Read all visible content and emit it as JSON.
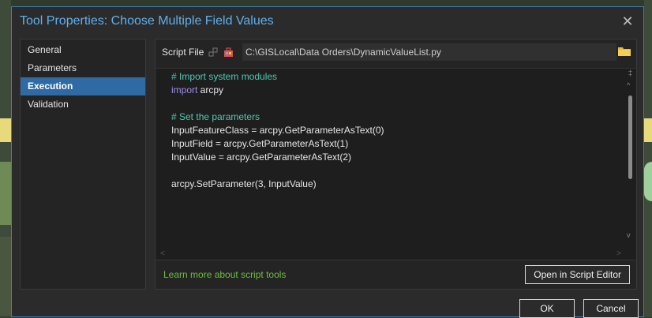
{
  "dialog": {
    "title": "Tool Properties: Choose Multiple Field Values",
    "close_glyph": "✕"
  },
  "sidebar": {
    "items": [
      {
        "label": "General",
        "active": false
      },
      {
        "label": "Parameters",
        "active": false
      },
      {
        "label": "Execution",
        "active": true
      },
      {
        "label": "Validation",
        "active": false
      }
    ]
  },
  "script": {
    "label": "Script File",
    "path": "C:\\GISLocal\\Data Orders\\DynamicValueList.py",
    "icons": [
      "unlink-icon",
      "toolbox-icon",
      "folder-icon"
    ]
  },
  "code": {
    "lines": [
      {
        "text": "# Import system modules",
        "kind": "comment"
      },
      {
        "text": "import",
        "kind": "keyword",
        "rest": " arcpy"
      },
      {
        "text": "",
        "kind": "text"
      },
      {
        "text": "# Set the parameters",
        "kind": "comment"
      },
      {
        "text": "InputFeatureClass = arcpy.GetParameterAsText(0)",
        "kind": "text"
      },
      {
        "text": "InputField = arcpy.GetParameterAsText(1)",
        "kind": "text"
      },
      {
        "text": "InputValue = arcpy.GetParameterAsText(2)",
        "kind": "text"
      },
      {
        "text": "",
        "kind": "text"
      },
      {
        "text": "arcpy.SetParameter(3, InputValue)",
        "kind": "text"
      }
    ]
  },
  "footer": {
    "learn_link": "Learn more about script tools",
    "open_editor": "Open in Script Editor"
  },
  "buttons": {
    "ok": "OK",
    "cancel": "Cancel"
  },
  "colors": {
    "accent": "#2f6aa5",
    "title": "#5fb0ee",
    "link": "#6bbf3b",
    "comment": "#4ec9b0",
    "keyword": "#9b8ee8"
  }
}
